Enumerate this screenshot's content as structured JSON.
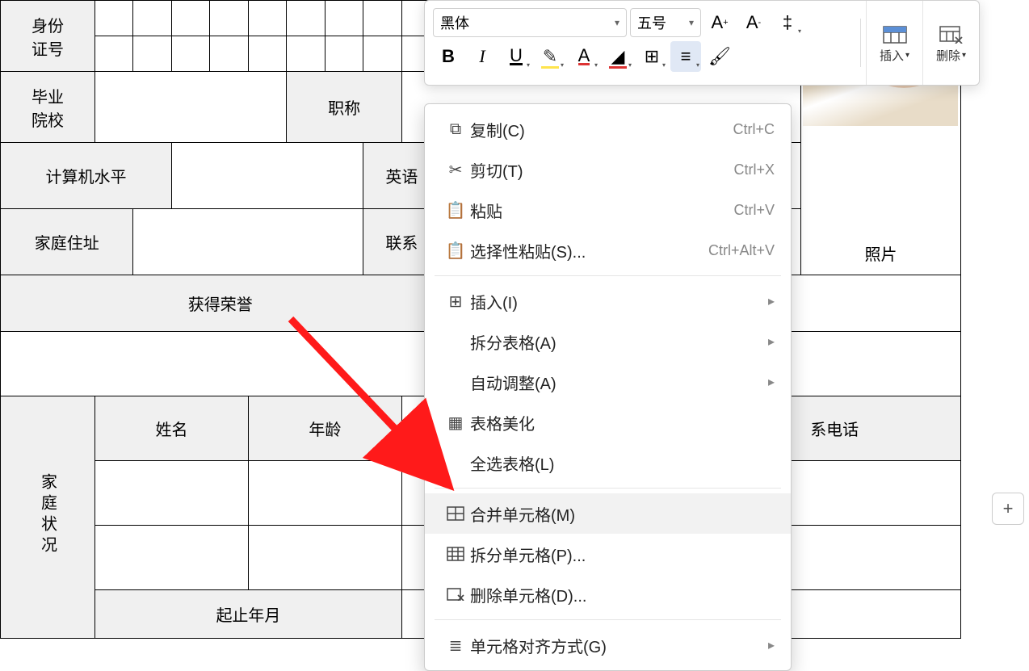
{
  "labels": {
    "id_no": "身份",
    "id_no2": "证号",
    "school": "毕业",
    "school2": "院校",
    "title": "职称",
    "computer": "计算机水平",
    "english": "英语",
    "address": "家庭住址",
    "contact": "联系",
    "honors": "获得荣誉",
    "family": "家庭状况",
    "name": "姓名",
    "age": "年龄",
    "phone": "系电话",
    "photo": "照片",
    "period": "起止年月"
  },
  "toolbar": {
    "font": "黑体",
    "size": "五号",
    "insert": "插入",
    "delete": "删除"
  },
  "ctx": {
    "copy": "复制(C)",
    "copy_sc": "Ctrl+C",
    "cut": "剪切(T)",
    "cut_sc": "Ctrl+X",
    "paste": "粘贴",
    "paste_sc": "Ctrl+V",
    "paste_special": "选择性粘贴(S)...",
    "ps_sc": "Ctrl+Alt+V",
    "insert": "插入(I)",
    "split_table": "拆分表格(A)",
    "autofit": "自动调整(A)",
    "beautify": "表格美化",
    "select_all": "全选表格(L)",
    "merge": "合并单元格(M)",
    "split_cell": "拆分单元格(P)...",
    "delete_cell": "删除单元格(D)...",
    "align": "单元格对齐方式(G)"
  }
}
